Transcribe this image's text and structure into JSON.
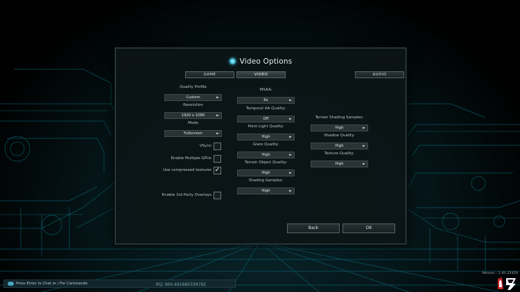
{
  "dialog": {
    "title": "Video Options",
    "tabs": [
      {
        "label": "GAME",
        "active": false
      },
      {
        "label": "VIDEO",
        "active": true
      },
      {
        "label": "AUDIO",
        "active": false
      }
    ]
  },
  "left_col": {
    "quality_profile": {
      "label": "Quality Profile",
      "value": "Custom"
    },
    "resolution": {
      "label": "Resolution",
      "value": "1920 x 1080"
    },
    "mode": {
      "label": "Mode",
      "value": "Fullscreen"
    },
    "vsync": {
      "label": "VSync",
      "checked": false
    },
    "multi_gpu": {
      "label": "Enable Multiple GPUs",
      "checked": false
    },
    "compressed_textures": {
      "label": "Use compressed textures",
      "checked": true
    },
    "third_party_overlays": {
      "label": "Enable 3rd Party Overlays",
      "checked": false
    },
    "check_mark": "✓"
  },
  "mid_col": {
    "msaa": {
      "label": "MSAA:",
      "value": "8x"
    },
    "temporal_aa": {
      "label": "Temporal AA Quality:",
      "value": "Off"
    },
    "point_light": {
      "label": "Point Light Quality:",
      "value": "High"
    },
    "glare": {
      "label": "Glare Quality:",
      "value": "High"
    },
    "terrain_object": {
      "label": "Terrain Object Quality:",
      "value": "High"
    },
    "shading_samples": {
      "label": "Shading Samples:",
      "value": "High"
    }
  },
  "right_col": {
    "terrain_shading": {
      "label": "Terrain Shading Samples:",
      "value": "High"
    },
    "shadow": {
      "label": "Shadow Quality:",
      "value": "High"
    },
    "texture": {
      "label": "Texture Quality:",
      "value": "High"
    }
  },
  "select_arrow": "►",
  "buttons": {
    "back": "Back",
    "ok": "OK"
  },
  "chat": {
    "prompt": "Press Enter to Chat or / For Commands"
  },
  "rq": "RQ: 900.491680339792",
  "version": "Version : 1.45.23939",
  "colors": {
    "accent": "#3ab7d4",
    "panel": "#0c1416",
    "control": "#2a3234"
  }
}
